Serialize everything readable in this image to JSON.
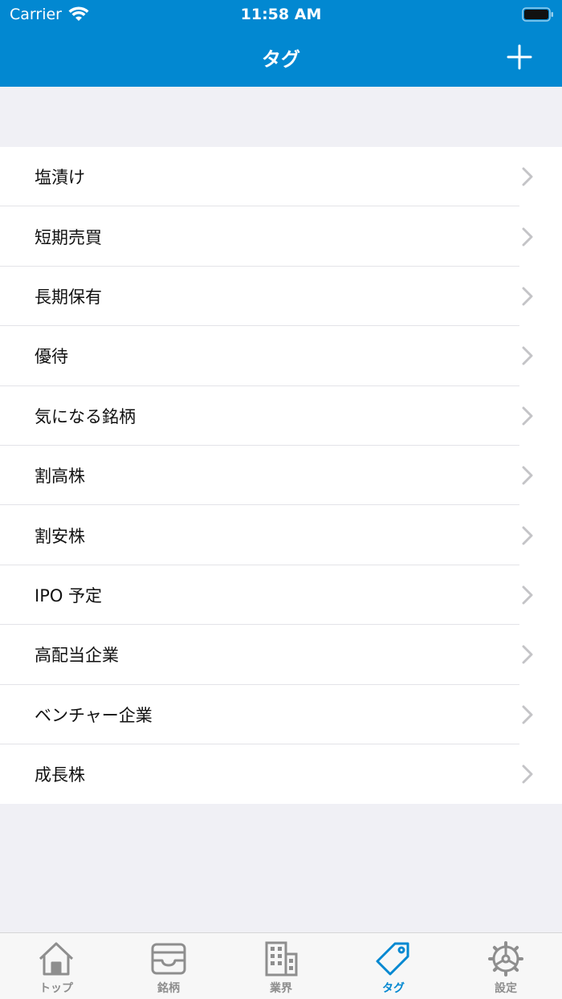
{
  "status_bar": {
    "carrier": "Carrier",
    "time": "11:58 AM"
  },
  "header": {
    "title": "タグ"
  },
  "tags": [
    "塩漬け",
    "短期売買",
    "長期保有",
    "優待",
    "気になる銘柄",
    "割高株",
    "割安株",
    "IPO 予定",
    "高配当企業",
    "ベンチャー企業",
    "成長株"
  ],
  "tab_bar": {
    "items": [
      {
        "label": "トップ",
        "icon": "home-icon"
      },
      {
        "label": "銘柄",
        "icon": "tray-icon"
      },
      {
        "label": "業界",
        "icon": "building-icon"
      },
      {
        "label": "タグ",
        "icon": "tag-icon"
      },
      {
        "label": "設定",
        "icon": "gear-icon"
      }
    ],
    "active_index": 3
  },
  "colors": {
    "accent": "#0288d1",
    "tab_inactive": "#8e8e8e",
    "background": "#f0f0f5"
  }
}
